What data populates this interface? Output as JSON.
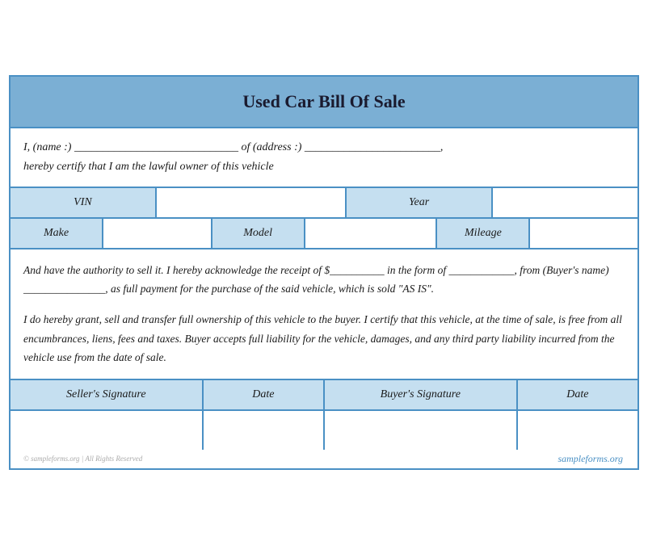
{
  "header": {
    "title": "Used Car Bill Of Sale"
  },
  "intro": {
    "line1": "I, (name :) _____________________________ of (address :) ________________________,",
    "line2": "hereby certify that I am the lawful owner of this vehicle"
  },
  "vehicle_row1": {
    "vin_label": "VIN",
    "year_label": "Year"
  },
  "vehicle_row2": {
    "make_label": "Make",
    "model_label": "Model",
    "mileage_label": "Mileage"
  },
  "body_paragraph1": "And have the authority to sell it. I hereby acknowledge the receipt of $__________ in the form of ____________, from (Buyer's name) _______________, as full payment for the purchase of the said vehicle, which is sold \"AS IS\".",
  "body_paragraph2": "I do hereby grant, sell and transfer full ownership of this vehicle to the buyer. I certify that this vehicle, at the time of sale, is free from all encumbrances, liens, fees and taxes. Buyer accepts full liability for the vehicle, damages, and any third party liability incurred from the vehicle use from the date of sale.",
  "signature": {
    "seller_label": "Seller's Signature",
    "seller_date_label": "Date",
    "buyer_label": "Buyer's Signature",
    "buyer_date_label": "Date"
  },
  "footer": {
    "watermark": "© sampleforms.org | All Rights Reserved",
    "site": "sampleforms.org"
  }
}
